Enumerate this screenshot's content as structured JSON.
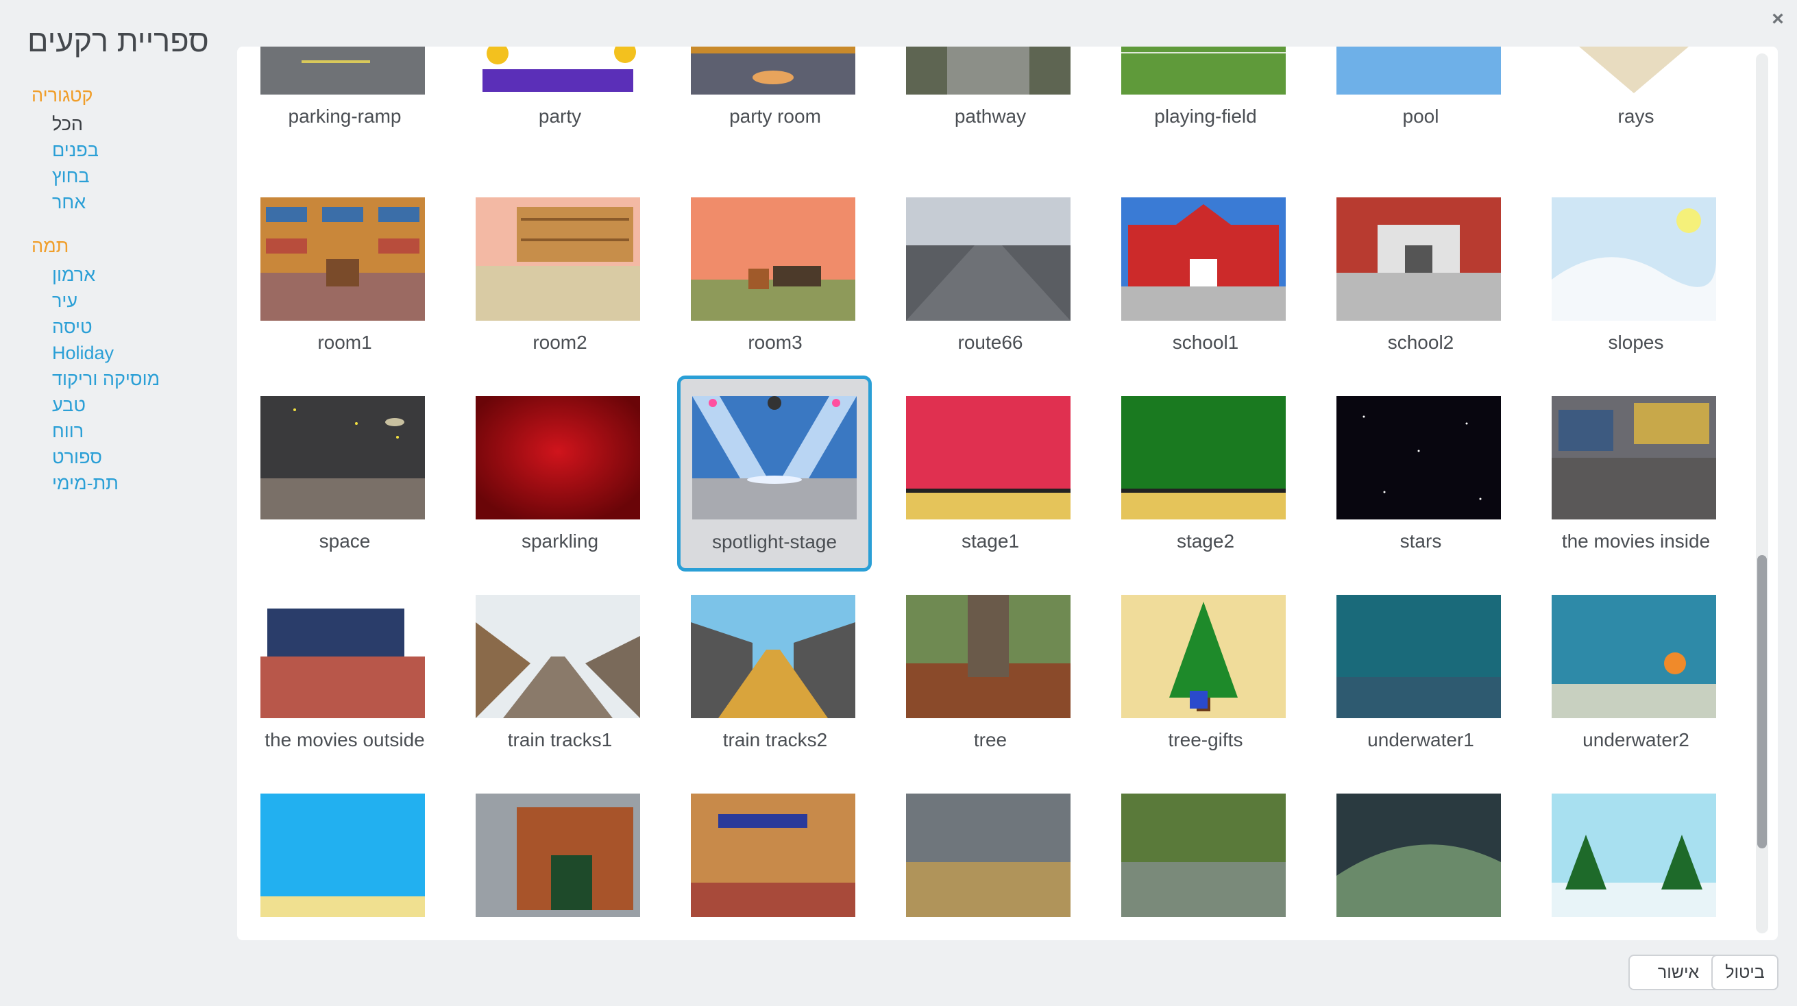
{
  "dialog": {
    "title": "ספריית רקעים",
    "close_symbol": "×",
    "ok_label": "אישור",
    "cancel_label": "ביטול"
  },
  "filters": {
    "category_heading": "קטגוריה",
    "categories": [
      "הכל",
      "בפנים",
      "בחוץ",
      "אחר"
    ],
    "active_category": "הכל",
    "theme_heading": "תמה",
    "themes": [
      "ארמון",
      "עיר",
      "טיסה",
      "Holiday",
      "מוסיקה וריקוד",
      "טבע",
      "רווח",
      "ספורט",
      "תת-מימי"
    ]
  },
  "library": {
    "selected": "spotlight-stage",
    "rows": [
      [
        "parking-ramp",
        "party",
        "party room",
        "pathway",
        "playing-field",
        "pool",
        "rays"
      ],
      [
        "room1",
        "room2",
        "room3",
        "route66",
        "school1",
        "school2",
        "slopes"
      ],
      [
        "space",
        "sparkling",
        "spotlight-stage",
        "stage1",
        "stage2",
        "stars",
        "the movies inside"
      ],
      [
        "the movies outside",
        "train tracks1",
        "train tracks2",
        "tree",
        "tree-gifts",
        "underwater1",
        "underwater2"
      ]
    ]
  },
  "colors": {
    "accent": "#2a9fd6",
    "section_heading": "#f09e2a"
  }
}
